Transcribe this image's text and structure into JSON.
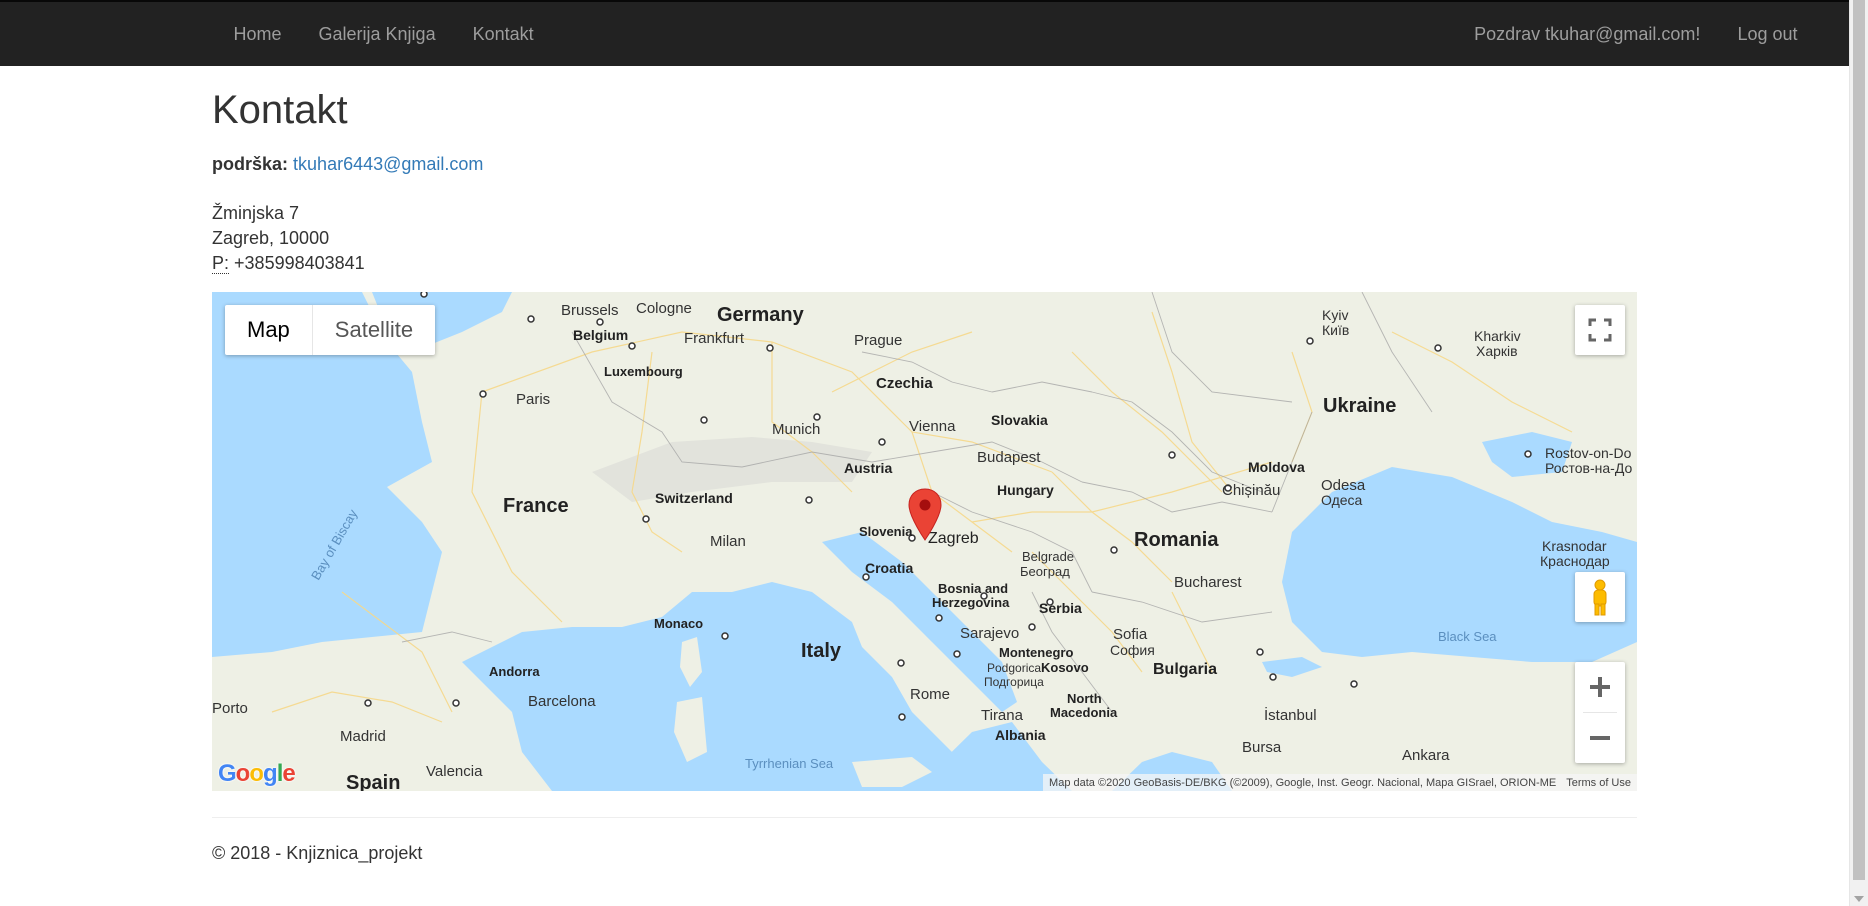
{
  "navbar": {
    "left_links": [
      "Home",
      "Galerija Knjiga",
      "Kontakt"
    ],
    "greeting": "Pozdrav tkuhar@gmail.com!",
    "logout": "Log out"
  },
  "page": {
    "title": "Kontakt",
    "support_label": "podrška:",
    "support_email": "tkuhar6443@gmail.com",
    "address_street": "Žminjska 7",
    "address_city": "Zagreb, 10000",
    "phone_label": "P:",
    "phone": "+385998403841"
  },
  "map": {
    "type_buttons": [
      "Map",
      "Satellite"
    ],
    "active_type": "Map",
    "attribution": "Map data ©2020 GeoBasis-DE/BKG (©2009), Google, Inst. Geogr. Nacional, Mapa GISrael, ORION-ME",
    "terms": "Terms of Use",
    "logo": "Google",
    "marker_location": "Zagreb",
    "labels": {
      "germany": "Germany",
      "brussels": "Brussels",
      "cologne": "Cologne",
      "belgium": "Belgium",
      "frankfurt": "Frankfurt",
      "luxembourg": "Luxembourg",
      "prague": "Prague",
      "czechia": "Czechia",
      "paris": "Paris",
      "munich": "Munich",
      "vienna": "Vienna",
      "slovakia": "Slovakia",
      "austria": "Austria",
      "budapest": "Budapest",
      "hungary": "Hungary",
      "france": "France",
      "switzerland": "Switzerland",
      "slovenia": "Slovenia",
      "zagreb": "Zagreb",
      "milan": "Milan",
      "croatia": "Croatia",
      "belgrade": "Belgrade",
      "belgrade_cyr": "Београд",
      "bosnia": "Bosnia and",
      "herzegovina": "Herzegovina",
      "serbia": "Serbia",
      "monaco": "Monaco",
      "sarajevo": "Sarajevo",
      "italy": "Italy",
      "montenegro": "Montenegro",
      "podgorica": "Podgorica",
      "podgorica_cyr": "Подгорица",
      "kosovo": "Kosovo",
      "sofia": "Sofia",
      "sofia_cyr": "София",
      "bulgaria": "Bulgaria",
      "romania": "Romania",
      "bucharest": "Bucharest",
      "moldova": "Moldova",
      "chisinau": "Chișinău",
      "odesa": "Odesa",
      "odesa_cyr": "Одеса",
      "ukraine": "Ukraine",
      "kyiv": "Kyiv",
      "kyiv_cyr": "Київ",
      "kharkiv": "Kharkiv",
      "kharkiv_cyr": "Харків",
      "rostov": "Rostov-on-Do",
      "rostov_cyr": "Ростов-на-До",
      "krasnodar": "Krasnodar",
      "krasnodar_cyr": "Краснодар",
      "black_sea": "Black Sea",
      "rome": "Rome",
      "tyrrhenian": "Tyrrhenian Sea",
      "tirana": "Tirana",
      "albania": "Albania",
      "north": "North",
      "macedonia": "Macedonia",
      "istanbul": "İstanbul",
      "bursa": "Bursa",
      "ankara": "Ankara",
      "andorra": "Andorra",
      "barcelona": "Barcelona",
      "madrid": "Madrid",
      "valencia": "Valencia",
      "spain": "Spain",
      "porto": "Porto",
      "biscay": "Bay of Biscay"
    }
  },
  "footer": {
    "text": "© 2018 - Knjiznica_projekt"
  },
  "colors": {
    "navbar_bg": "#222222",
    "nav_text": "#9d9d9d",
    "link": "#337ab7",
    "water": "#aadaff",
    "land": "#eef0e5",
    "marker": "#ea4335"
  }
}
